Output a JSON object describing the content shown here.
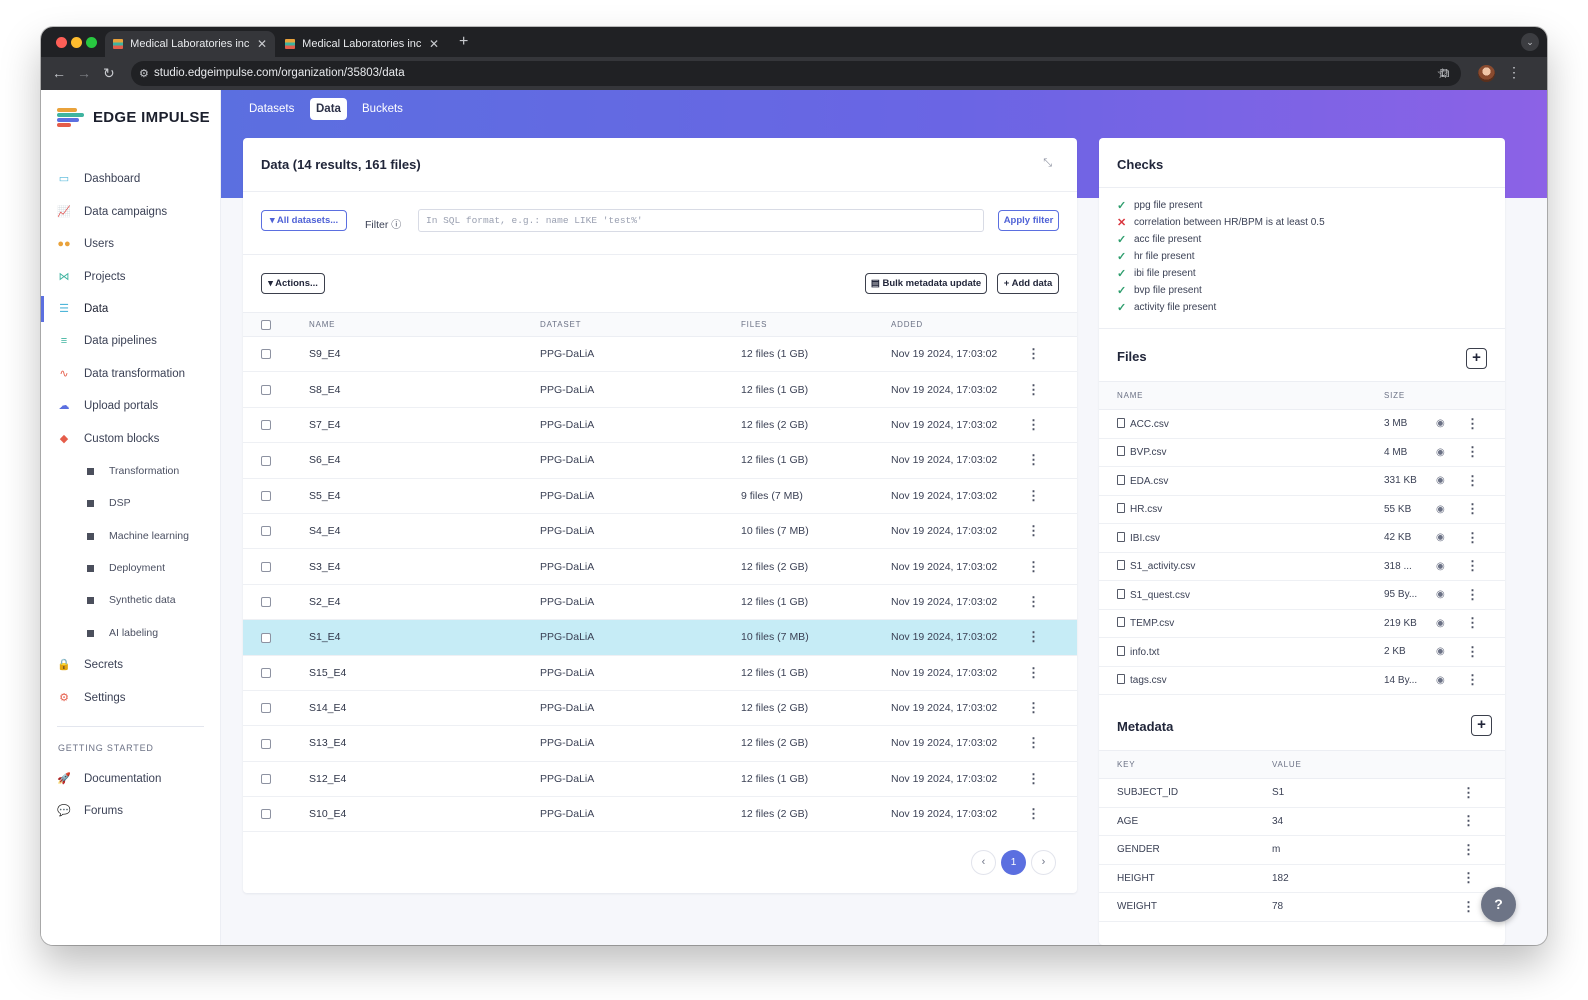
{
  "browser": {
    "tabs": [
      {
        "title": "Medical Laboratories inc. - D"
      },
      {
        "title": "Medical Laboratories inc. - ac"
      }
    ],
    "url": "studio.edgeimpulse.com/organization/35803/data"
  },
  "app": {
    "logo_text": "EDGE IMPULSE",
    "sidebar": {
      "items": [
        {
          "label": "Dashboard",
          "icon": "monitor-icon"
        },
        {
          "label": "Data campaigns",
          "icon": "chart-icon"
        },
        {
          "label": "Users",
          "icon": "users-icon"
        },
        {
          "label": "Projects",
          "icon": "projects-icon"
        },
        {
          "label": "Data",
          "icon": "database-icon"
        },
        {
          "label": "Data pipelines",
          "icon": "pipeline-icon"
        },
        {
          "label": "Data transformation",
          "icon": "transform-icon"
        },
        {
          "label": "Upload portals",
          "icon": "cloud-upload-icon"
        },
        {
          "label": "Custom blocks",
          "icon": "cube-icon"
        }
      ],
      "sub_items": [
        {
          "label": "Transformation"
        },
        {
          "label": "DSP"
        },
        {
          "label": "Machine learning"
        },
        {
          "label": "Deployment"
        },
        {
          "label": "Synthetic data"
        },
        {
          "label": "AI labeling"
        }
      ],
      "bottom_items": [
        {
          "label": "Secrets",
          "icon": "lock-icon"
        },
        {
          "label": "Settings",
          "icon": "gear-icon"
        }
      ],
      "section_label": "GETTING STARTED",
      "getting_started": [
        {
          "label": "Documentation",
          "icon": "rocket-icon"
        },
        {
          "label": "Forums",
          "icon": "chat-icon"
        }
      ]
    },
    "top_tabs": [
      {
        "label": "Datasets"
      },
      {
        "label": "Data"
      },
      {
        "label": "Buckets"
      }
    ],
    "data_card": {
      "title": "Data (14 results, 161 files)",
      "all_datasets_label": "All datasets...",
      "filter_label": "Filter",
      "filter_placeholder": "In SQL format, e.g.: name LIKE 'test%'",
      "apply_filter_label": "Apply filter",
      "actions_label": "Actions...",
      "bulk_update_label": "Bulk metadata update",
      "add_data_label": "Add data",
      "columns": [
        "NAME",
        "DATASET",
        "FILES",
        "ADDED"
      ],
      "rows": [
        {
          "name": "S9_E4",
          "dataset": "PPG-DaLiA",
          "files": "12 files (1 GB)",
          "added": "Nov 19 2024, 17:03:02"
        },
        {
          "name": "S8_E4",
          "dataset": "PPG-DaLiA",
          "files": "12 files (1 GB)",
          "added": "Nov 19 2024, 17:03:02"
        },
        {
          "name": "S7_E4",
          "dataset": "PPG-DaLiA",
          "files": "12 files (2 GB)",
          "added": "Nov 19 2024, 17:03:02"
        },
        {
          "name": "S6_E4",
          "dataset": "PPG-DaLiA",
          "files": "12 files (1 GB)",
          "added": "Nov 19 2024, 17:03:02"
        },
        {
          "name": "S5_E4",
          "dataset": "PPG-DaLiA",
          "files": "9 files (7 MB)",
          "added": "Nov 19 2024, 17:03:02"
        },
        {
          "name": "S4_E4",
          "dataset": "PPG-DaLiA",
          "files": "10 files (7 MB)",
          "added": "Nov 19 2024, 17:03:02"
        },
        {
          "name": "S3_E4",
          "dataset": "PPG-DaLiA",
          "files": "12 files (2 GB)",
          "added": "Nov 19 2024, 17:03:02"
        },
        {
          "name": "S2_E4",
          "dataset": "PPG-DaLiA",
          "files": "12 files (1 GB)",
          "added": "Nov 19 2024, 17:03:02"
        },
        {
          "name": "S1_E4",
          "dataset": "PPG-DaLiA",
          "files": "10 files (7 MB)",
          "added": "Nov 19 2024, 17:03:02",
          "selected": true
        },
        {
          "name": "S15_E4",
          "dataset": "PPG-DaLiA",
          "files": "12 files (1 GB)",
          "added": "Nov 19 2024, 17:03:02"
        },
        {
          "name": "S14_E4",
          "dataset": "PPG-DaLiA",
          "files": "12 files (2 GB)",
          "added": "Nov 19 2024, 17:03:02"
        },
        {
          "name": "S13_E4",
          "dataset": "PPG-DaLiA",
          "files": "12 files (2 GB)",
          "added": "Nov 19 2024, 17:03:02"
        },
        {
          "name": "S12_E4",
          "dataset": "PPG-DaLiA",
          "files": "12 files (1 GB)",
          "added": "Nov 19 2024, 17:03:02"
        },
        {
          "name": "S10_E4",
          "dataset": "PPG-DaLiA",
          "files": "12 files (2 GB)",
          "added": "Nov 19 2024, 17:03:02"
        }
      ],
      "current_page": "1"
    },
    "checks": {
      "title": "Checks",
      "items": [
        {
          "label": "ppg file present",
          "status": "pass"
        },
        {
          "label": "correlation between HR/BPM is at least 0.5",
          "status": "fail"
        },
        {
          "label": "acc file present",
          "status": "pass"
        },
        {
          "label": "hr file present",
          "status": "pass"
        },
        {
          "label": "ibi file present",
          "status": "pass"
        },
        {
          "label": "bvp file present",
          "status": "pass"
        },
        {
          "label": "activity file present",
          "status": "pass"
        }
      ]
    },
    "files": {
      "title": "Files",
      "columns": [
        "NAME",
        "SIZE"
      ],
      "rows": [
        {
          "name": "ACC.csv",
          "size": "3 MB"
        },
        {
          "name": "BVP.csv",
          "size": "4 MB"
        },
        {
          "name": "EDA.csv",
          "size": "331 KB"
        },
        {
          "name": "HR.csv",
          "size": "55 KB"
        },
        {
          "name": "IBI.csv",
          "size": "42 KB"
        },
        {
          "name": "S1_activity.csv",
          "size": "318 ..."
        },
        {
          "name": "S1_quest.csv",
          "size": "95 By..."
        },
        {
          "name": "TEMP.csv",
          "size": "219 KB"
        },
        {
          "name": "info.txt",
          "size": "2 KB"
        },
        {
          "name": "tags.csv",
          "size": "14 By..."
        }
      ]
    },
    "metadata": {
      "title": "Metadata",
      "columns": [
        "KEY",
        "VALUE"
      ],
      "rows": [
        {
          "key": "SUBJECT_ID",
          "value": "S1"
        },
        {
          "key": "AGE",
          "value": "34"
        },
        {
          "key": "GENDER",
          "value": "m"
        },
        {
          "key": "HEIGHT",
          "value": "182"
        },
        {
          "key": "WEIGHT",
          "value": "78"
        }
      ]
    }
  },
  "colors": {
    "accent": "#5b6fe0",
    "selected_row": "#c6ecf6",
    "check_pass": "#2f9e6e",
    "check_fail": "#d9363e"
  }
}
